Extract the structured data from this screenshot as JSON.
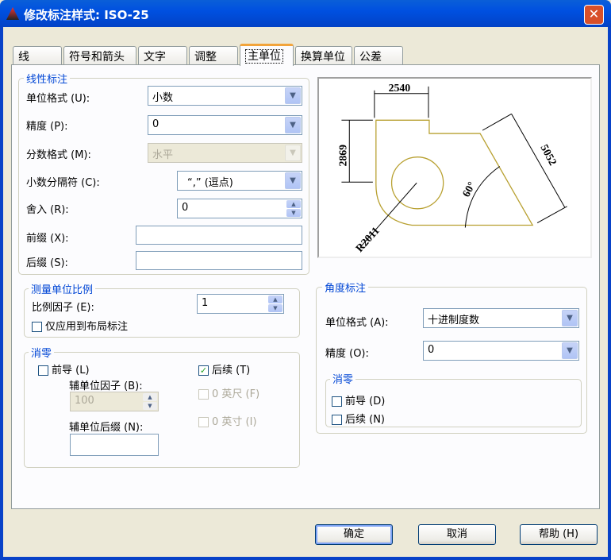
{
  "window": {
    "title": "修改标注样式: ISO-25",
    "close": "✕"
  },
  "tabs": [
    "线",
    "符号和箭头",
    "文字",
    "调整",
    "主单位",
    "换算单位",
    "公差"
  ],
  "linear": {
    "title": "线性标注",
    "unit_format": {
      "label": "单位格式 (U):",
      "value": "小数"
    },
    "precision": {
      "label": "精度 (P):",
      "value": "0"
    },
    "fraction_format": {
      "label": "分数格式 (M):",
      "value": "水平"
    },
    "decimal_separator": {
      "label": "小数分隔符 (C):",
      "value": "“,”  (逗点)"
    },
    "round_off": {
      "label": "舍入 (R):",
      "value": "0"
    },
    "prefix": {
      "label": "前缀 (X):",
      "value": ""
    },
    "suffix": {
      "label": "后缀 (S):",
      "value": ""
    }
  },
  "scale": {
    "title": "测量单位比例",
    "factor_label": "比例因子 (E):",
    "factor_value": "1",
    "layout_only": "仅应用到布局标注",
    "layout_only_checked": false
  },
  "zero": {
    "title": "消零",
    "leading": "前导 (L)",
    "leading_checked": false,
    "sub_factor_label": "辅单位因子 (B):",
    "sub_factor_value": "100",
    "sub_suffix_label": "辅单位后缀 (N):",
    "trailing": "后续 (T)",
    "trailing_checked": true,
    "feet": "0 英尺 (F)",
    "inches": "0 英寸 (I)"
  },
  "preview": {
    "dim_top": "2540",
    "dim_left": "2869",
    "dim_right": "5052",
    "angle": "60°",
    "radius": "R2011"
  },
  "angular": {
    "title": "角度标注",
    "unit_format": {
      "label": "单位格式 (A):",
      "value": "十进制度数"
    },
    "precision": {
      "label": "精度 (O):",
      "value": "0"
    },
    "zero": {
      "title": "消零",
      "leading": "前导 (D)",
      "trailing": "后续 (N)"
    }
  },
  "buttons": {
    "ok": "确定",
    "cancel": "取消",
    "help": "帮助 (H)"
  }
}
